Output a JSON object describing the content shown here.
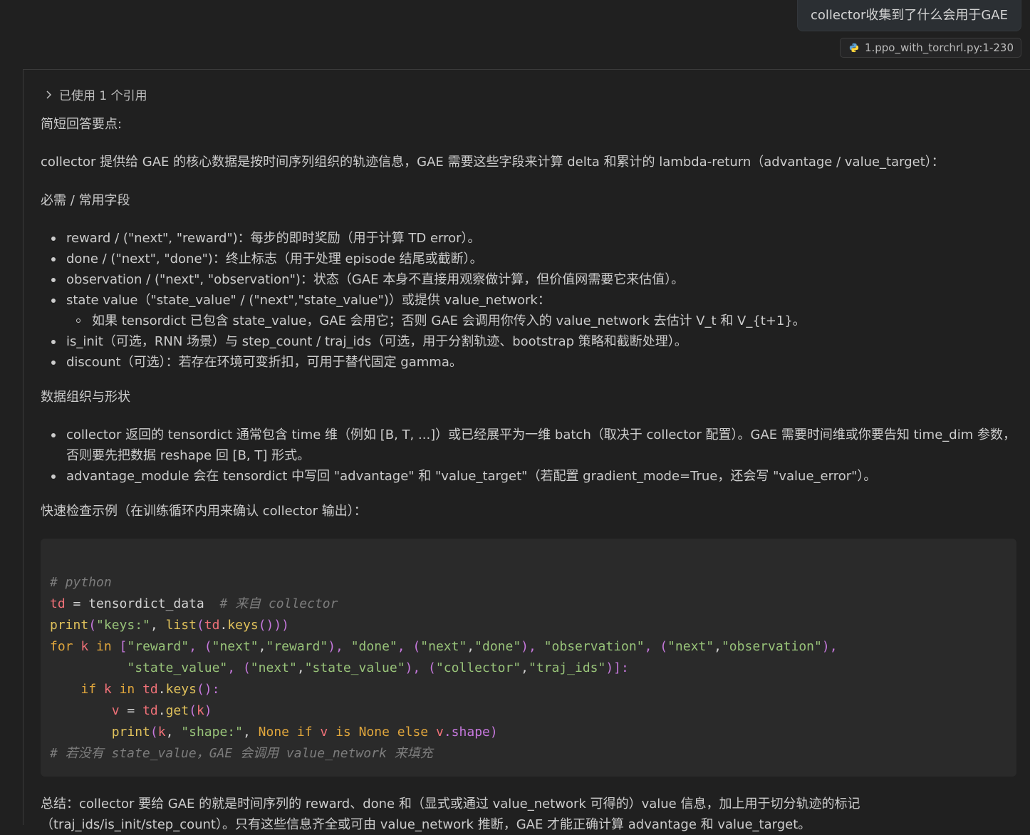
{
  "user_message": "collector收集到了什么会用于GAE",
  "reference_chip": {
    "icon": "python-icon",
    "label": "1.ppo_with_torchrl.py:1-230"
  },
  "references_toggle": "已使用 1 个引用",
  "answer": {
    "p1": "简短回答要点:",
    "p2": "collector 提供给 GAE 的核心数据是按时间序列组织的轨迹信息，GAE 需要这些字段来计算 delta 和累计的 lambda-return（advantage / value_target）：",
    "h1": "必需 / 常用字段",
    "fields": [
      "reward / (\"next\", \"reward\")：每步的即时奖励（用于计算 TD error）。",
      "done / (\"next\", \"done\")：终止标志（用于处理 episode 结尾或截断）。",
      "observation / (\"next\", \"observation\")：状态（GAE 本身不直接用观察做计算，但价值网需要它来估值）。",
      "state value（\"state_value\" / (\"next\",\"state_value\")）或提供 value_network：",
      "is_init（可选，RNN 场景）与 step_count / traj_ids（可选，用于分割轨迹、bootstrap 策略和截断处理）。",
      "discount（可选）：若存在环境可变折扣，可用于替代固定 gamma。"
    ],
    "sub_field": "如果 tensordict 已包含 state_value，GAE 会用它；否则 GAE 会调用你传入的 value_network 去估计 V_t 和 V_{t+1}。",
    "h2": "数据组织与形状",
    "shape_items": [
      "collector 返回的 tensordict 通常包含 time 维（例如 [B, T, ...]）或已经展平为一维 batch（取决于 collector 配置）。GAE 需要时间维或你要告知 time_dim 参数，否则要先把数据 reshape 回 [B, T] 形式。",
      "advantage_module 会在 tensordict 中写回 \"advantage\" 和 \"value_target\"（若配置 gradient_mode=True，还会写 \"value_error\"）。"
    ],
    "h3": "快速检查示例（在训练循环内用来确认 collector 输出）：",
    "summary": "总结：collector 要给 GAE 的就是时间序列的 reward、done 和（显式或通过 value_network 可得的）value 信息，加上用于切分轨迹的标记（traj_ids/is_init/step_count）。只有这些信息齐全或可由 value_network 推断，GAE 才能正确计算 advantage 和 value_target。"
  },
  "code": {
    "l1": "# python",
    "l2_var": "td",
    "l2_eq": " = ",
    "l2_val": "tensordict_data",
    "l2_cm": "  # 来自 collector",
    "l3_fn": "print",
    "l3_a": "(",
    "l3_s": "\"keys:\"",
    "l3_b": ", ",
    "l3_fn2": "list",
    "l3_c": "(",
    "l3_td": "td",
    "l3_d": ".",
    "l3_keys": "keys",
    "l3_e": "()))",
    "l4_for": "for",
    "l4_k": " k ",
    "l4_in": "in",
    "l4_rest1": " [",
    "l4_s1": "\"reward\"",
    "l4_r2": ", (",
    "l4_s2": "\"next\"",
    "l4_r3": ",",
    "l4_s3": "\"reward\"",
    "l4_r4": "), ",
    "l4_s4": "\"done\"",
    "l4_r5": ", (",
    "l4_s5": "\"next\"",
    "l4_r6": ",",
    "l4_s6": "\"done\"",
    "l4_r7": "), ",
    "l4_s7": "\"observation\"",
    "l4_r8": ", (",
    "l4_s8": "\"next\"",
    "l4_r9": ",",
    "l4_s9": "\"observation\"",
    "l4_r10": "),",
    "l5_pad": "          ",
    "l5_s1": "\"state_value\"",
    "l5_r1": ", (",
    "l5_s2": "\"next\"",
    "l5_r2": ",",
    "l5_s3": "\"state_value\"",
    "l5_r3": "), (",
    "l5_s4": "\"collector\"",
    "l5_r4": ",",
    "l5_s5": "\"traj_ids\"",
    "l5_r5": ")]:",
    "l6_pad": "    ",
    "l6_if": "if",
    "l6_k": " k ",
    "l6_in": "in",
    "l6_td": " td",
    "l6_dot": ".",
    "l6_keys": "keys",
    "l6_end": "():",
    "l7_pad": "        ",
    "l7_v": "v",
    "l7_eq": " = ",
    "l7_td": "td",
    "l7_dot": ".",
    "l7_get": "get",
    "l7_a": "(",
    "l7_k": "k",
    "l7_b": ")",
    "l8_pad": "        ",
    "l8_print": "print",
    "l8_a": "(",
    "l8_k": "k",
    "l8_b": ", ",
    "l8_s": "\"shape:\"",
    "l8_c": ", ",
    "l8_none1": "None",
    "l8_sp1": " ",
    "l8_if": "if",
    "l8_v": " v ",
    "l8_is": "is",
    "l8_sp2": " ",
    "l8_none2": "None",
    "l8_sp3": " ",
    "l8_else": "else",
    "l8_v2": " v",
    "l8_rest": ".shape)",
    "l9": "# 若没有 state_value，GAE 会调用 value_network 来填充"
  }
}
